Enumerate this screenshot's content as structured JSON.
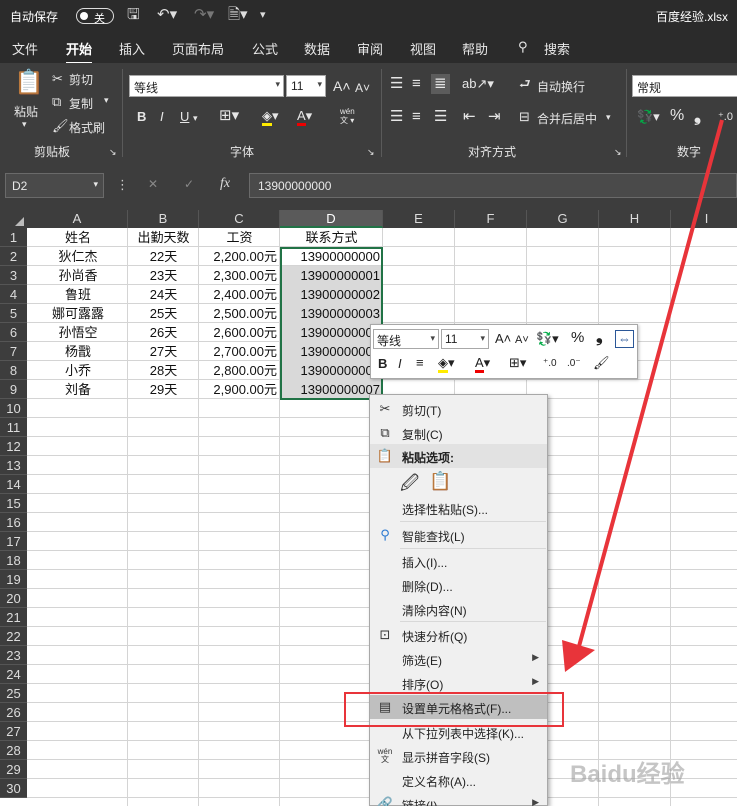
{
  "titlebar": {
    "autosave_label": "自动保存",
    "autosave_state": "关",
    "filename": "百度经验.xlsx"
  },
  "tabs": [
    "文件",
    "开始",
    "插入",
    "页面布局",
    "公式",
    "数据",
    "审阅",
    "视图",
    "帮助",
    "搜索"
  ],
  "active_tab": "开始",
  "ribbon": {
    "clipboard": {
      "paste": "粘贴",
      "cut": "剪切",
      "copy": "复制",
      "format_painter": "格式刷",
      "group": "剪贴板"
    },
    "font": {
      "name": "等线",
      "size": "11",
      "bold": "B",
      "italic": "I",
      "underline": "U",
      "font_color": "A",
      "grow": "A",
      "shrink": "A",
      "phonetic": "wén",
      "group": "字体"
    },
    "alignment": {
      "wrap": "自动换行",
      "merge": "合并后居中",
      "group": "对齐方式"
    },
    "number": {
      "format": "常规",
      "percent": "%",
      "comma": "❟",
      "group": "数字"
    }
  },
  "formula_bar": {
    "name_box": "D2",
    "cancel": "✕",
    "enter": "✓",
    "fx": "fx",
    "content": "13900000000"
  },
  "columns": [
    "A",
    "B",
    "C",
    "D",
    "E",
    "F",
    "G",
    "H",
    "I"
  ],
  "selected_column": "D",
  "row_numbers": [
    "1",
    "2",
    "3",
    "4",
    "5",
    "6",
    "7",
    "8",
    "9",
    "10",
    "11",
    "12",
    "13",
    "14",
    "15",
    "16",
    "17",
    "18",
    "19",
    "20",
    "21",
    "22",
    "23",
    "24",
    "25",
    "26",
    "27",
    "28",
    "29",
    "30"
  ],
  "sheet": {
    "headers": [
      "姓名",
      "出勤天数",
      "工资",
      "联系方式"
    ],
    "rows": [
      [
        "狄仁杰",
        "22天",
        "2,200.00元",
        "13900000000"
      ],
      [
        "孙尚香",
        "23天",
        "2,300.00元",
        "13900000001"
      ],
      [
        "鲁班",
        "24天",
        "2,400.00元",
        "13900000002"
      ],
      [
        "娜可露露",
        "25天",
        "2,500.00元",
        "13900000003"
      ],
      [
        "孙悟空",
        "26天",
        "2,600.00元",
        "13900000004"
      ],
      [
        "杨戬",
        "27天",
        "2,700.00元",
        "13900000005"
      ],
      [
        "小乔",
        "28天",
        "2,800.00元",
        "13900000006"
      ],
      [
        "刘备",
        "29天",
        "2,900.00元",
        "13900000007"
      ]
    ]
  },
  "mini_toolbar": {
    "font": "等线",
    "size": "11",
    "grow": "A",
    "shrink": "A",
    "percent": "%",
    "comma": "❟",
    "bold": "B",
    "italic": "I",
    "font_color": "A"
  },
  "context_menu": {
    "cut": "剪切(T)",
    "copy": "复制(C)",
    "paste_options": "粘贴选项:",
    "paste_special": "选择性粘贴(S)...",
    "smart_lookup": "智能查找(L)",
    "insert": "插入(I)...",
    "delete": "删除(D)...",
    "clear": "清除内容(N)",
    "quick_analysis": "快速分析(Q)",
    "filter": "筛选(E)",
    "sort": "排序(O)",
    "format_cells": "设置单元格格式(F)...",
    "pick_list": "从下拉列表中选择(K)...",
    "phonetic": "显示拼音字段(S)",
    "define_name": "定义名称(A)...",
    "link": "链接(I)"
  },
  "watermark": "Baidu经验",
  "colors": {
    "dark_bg": "#2b2b2b",
    "ribbon_bg": "#3d3d3d",
    "selection_border": "#217346",
    "highlight": "#e8343a",
    "arrow": "#e8343a"
  }
}
